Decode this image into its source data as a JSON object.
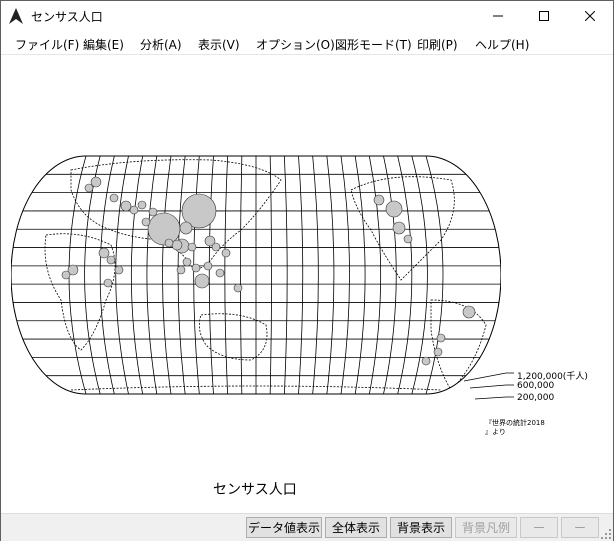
{
  "window": {
    "title": "センサス人口"
  },
  "menu": [
    "ファイル(F)",
    "編集(E)",
    "分析(A)",
    "表示(V)",
    "オプション(O)",
    "図形モード(T)",
    "印刷(P)",
    "ヘルプ(H)"
  ],
  "map": {
    "title": "センサス人口",
    "legend": [
      "1,200,000(千人)",
      "600,000",
      "200,000"
    ],
    "source_line1": "『世界の統計2018",
    "source_line2": "』より"
  },
  "buttons": {
    "data_values": "データ値表示",
    "full_view": "全体表示",
    "background": "背景表示",
    "background_legend": "背景凡例",
    "extra1": "ー",
    "extra2": "ー"
  },
  "icons": [
    "app-icon",
    "minimize-icon",
    "maximize-icon",
    "close-icon",
    "resize-grip-icon"
  ]
}
